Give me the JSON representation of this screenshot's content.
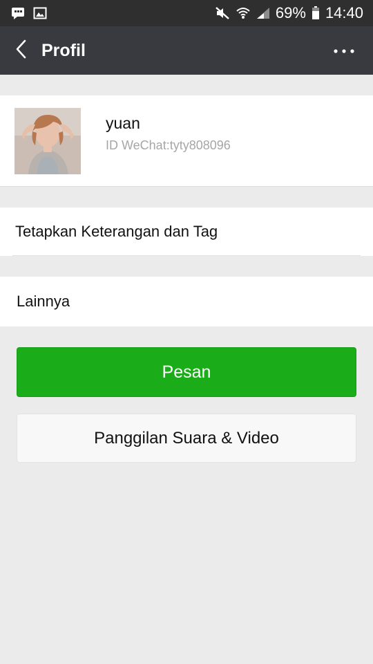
{
  "status_bar": {
    "battery_percent": "69%",
    "time": "14:40",
    "icons": [
      "bbm-icon",
      "gallery-icon",
      "mute-icon",
      "wifi-icon",
      "signal-icon",
      "battery-icon"
    ]
  },
  "header": {
    "title": "Profil",
    "back_icon": "chevron-left-icon",
    "more_icon": "more-dots-icon"
  },
  "profile": {
    "name": "yuan",
    "wechat_id": "ID WeChat:tyty808096"
  },
  "rows": {
    "tags_label": "Tetapkan Keterangan dan Tag",
    "more_label": "Lainnya"
  },
  "actions": {
    "message_label": "Pesan",
    "call_label": "Panggilan Suara & Video"
  },
  "colors": {
    "status_bar": "#2f2f2f",
    "title_bar": "#393a3f",
    "primary_button": "#1aad19",
    "background": "#ebebeb"
  }
}
